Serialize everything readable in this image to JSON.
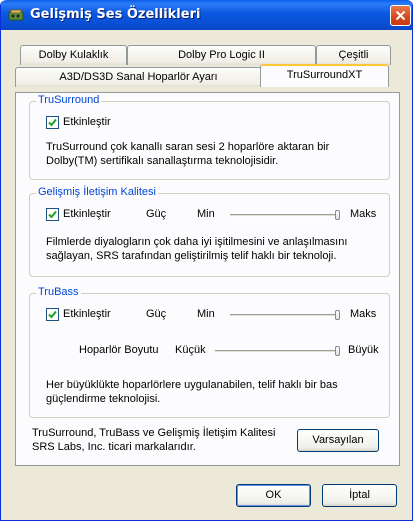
{
  "window": {
    "title": "Gelişmiş Ses Özellikleri"
  },
  "tabs_row1": [
    {
      "label": "Dolby Kulaklık"
    },
    {
      "label": "Dolby Pro Logic II"
    },
    {
      "label": "Çeşitli"
    }
  ],
  "tabs_row2": [
    {
      "label": "A3D/DS3D Sanal Hoparlör Ayarı"
    },
    {
      "label": "TruSurroundXT",
      "active": true
    }
  ],
  "trusurround": {
    "legend": "TruSurround",
    "enable_label": "Etkinleştir",
    "enable_checked": true,
    "description": "TruSurround çok kanallı saran sesi 2 hoparlöre aktaran bir Dolby(TM) sertifikalı sanallaştırma teknolojisidir."
  },
  "dialog_clarity": {
    "legend": "Gelişmiş İletişim Kalitesi",
    "enable_label": "Etkinleştir",
    "enable_checked": true,
    "gain_label": "Güç",
    "min_label": "Min",
    "max_label": "Maks",
    "gain_level": 1.0,
    "description": "Filmlerde diyalogların çok daha iyi işitilmesini ve anlaşılmasını sağlayan, SRS tarafından geliştirilmiş telif haklı bir teknoloji."
  },
  "trubass": {
    "legend": "TruBass",
    "enable_label": "Etkinleştir",
    "enable_checked": true,
    "gain_label": "Güç",
    "min_label": "Min",
    "max_label": "Maks",
    "gain_level": 1.0,
    "speaker_size_label": "Hoparlör Boyutu",
    "small_label": "Küçük",
    "large_label": "Büyük",
    "speaker_size_level": 1.0,
    "description": "Her büyüklükte hoparlörlere uygulanabilen, telif haklı bir bas güçlendirme teknolojisi."
  },
  "footer": {
    "trademark": "TruSurround, TruBass ve Gelişmiş İletişim Kalitesi SRS Labs, Inc. ticari markalarıdır.",
    "defaults_button": "Varsayılan"
  },
  "buttons": {
    "ok": "OK",
    "cancel": "İptal"
  },
  "colors": {
    "titlebar": "#0a52dc",
    "legend": "#0046d5",
    "active_tab_accent": "#ffc83c",
    "dialog_bg": "#ece9d8"
  }
}
